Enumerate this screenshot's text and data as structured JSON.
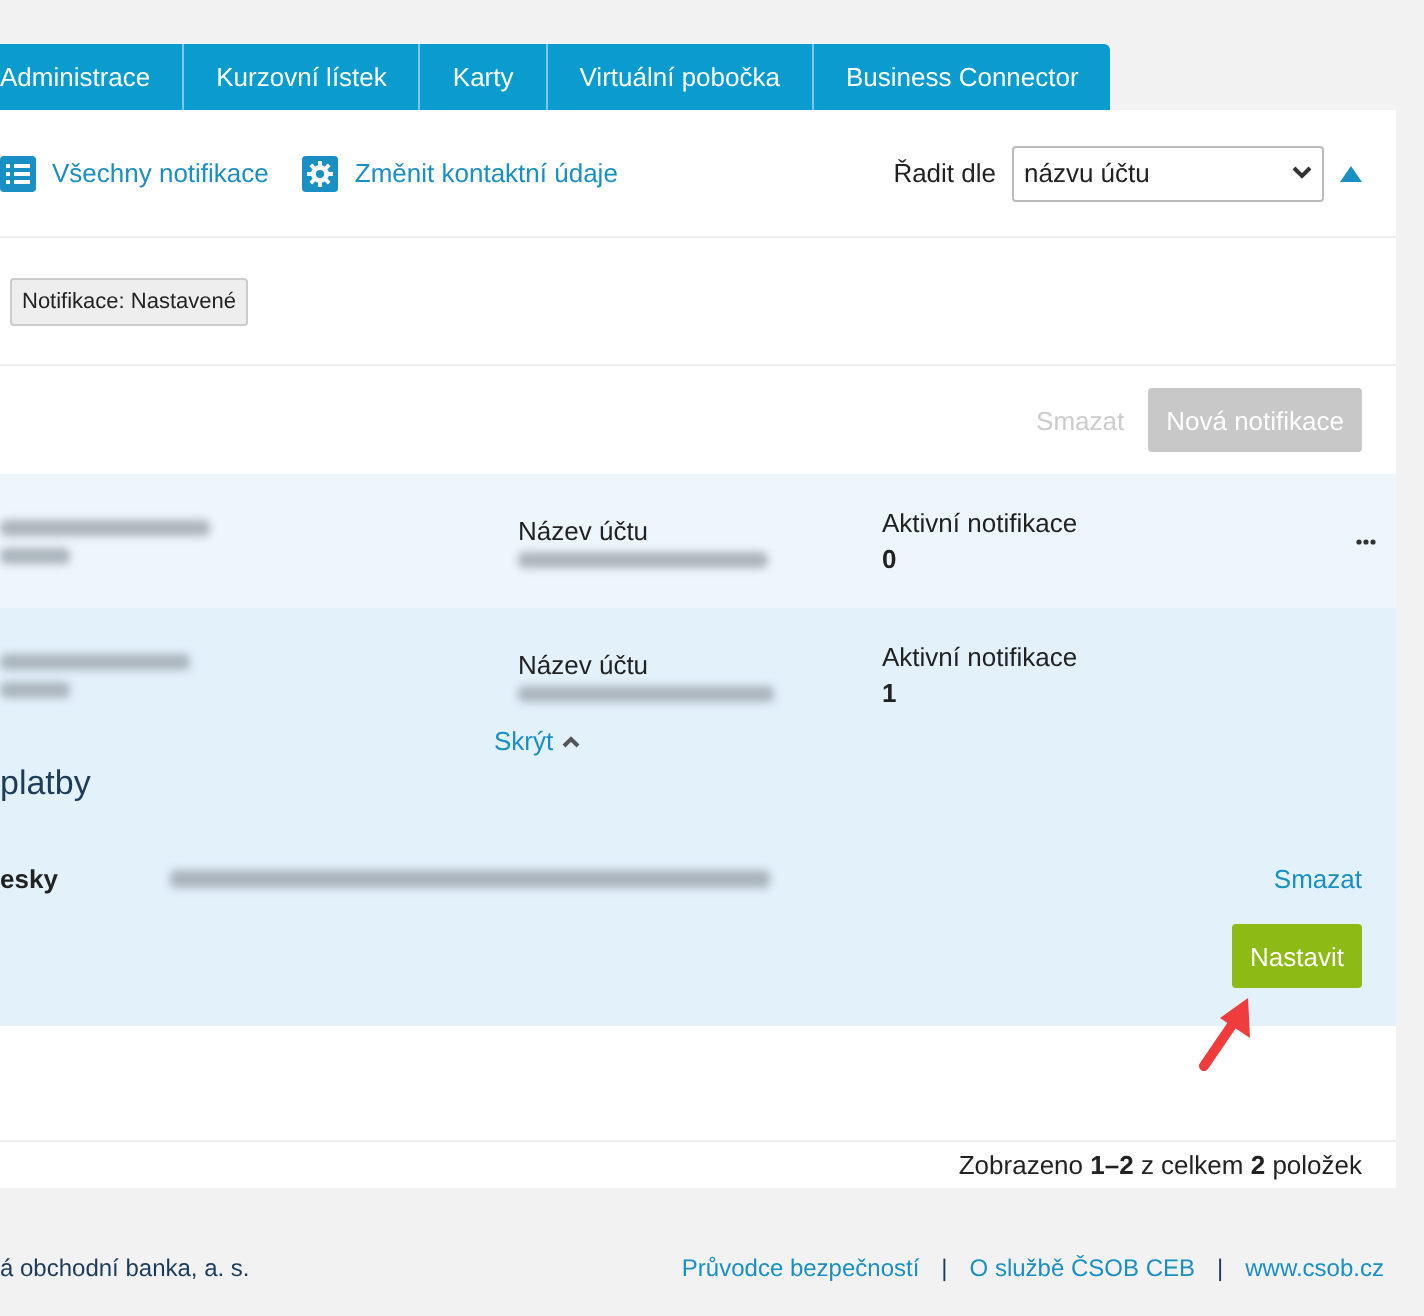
{
  "tabs": [
    {
      "label": "Administrace",
      "selected": false
    },
    {
      "label": "Kurzovní lístek",
      "selected": false
    },
    {
      "label": "Karty",
      "selected": false
    },
    {
      "label": "Virtuální pobočka",
      "selected": false
    },
    {
      "label": "Business Connector",
      "selected": false
    }
  ],
  "toolbar": {
    "links": [
      {
        "label": "Všechny notifikace",
        "kind": "list"
      },
      {
        "label": "Změnit kontaktní údaje",
        "kind": "gear"
      }
    ],
    "sort": {
      "label": "Řadit dle",
      "value": "názvu účtu",
      "ascending": true
    }
  },
  "filter_chip": "Notifikace: Nastavené",
  "actions": [
    {
      "label": "Smazat",
      "kind": "link",
      "disabled": true
    },
    {
      "label": "Nová notifikace",
      "kind": "button",
      "disabled": true
    }
  ],
  "accounts": [
    {
      "account_label": "Název účtu",
      "active_label": "Aktivní notifikace",
      "active_count": "0",
      "expanded": false
    },
    {
      "account_label": "Název účtu",
      "active_label": "Aktivní notifikace",
      "active_count": "1",
      "expanded": true,
      "toggle": "Skrýt",
      "heading": "platby",
      "channel": "esky",
      "delete": "Smazat",
      "submit": "Nastavit"
    }
  ],
  "pagination": "Zobrazeno **1–2** z celkem **2** položek",
  "footer": {
    "company": "á obchodní banka, a. s.",
    "items": [
      {
        "kind": "link",
        "text": "Průvodce bezpečností"
      },
      {
        "kind": "separator",
        "text": "|"
      },
      {
        "kind": "link",
        "text": "O službě ČSOB CEB"
      },
      {
        "kind": "separator",
        "text": "|"
      },
      {
        "kind": "link",
        "text": "www.csob.cz"
      }
    ]
  }
}
